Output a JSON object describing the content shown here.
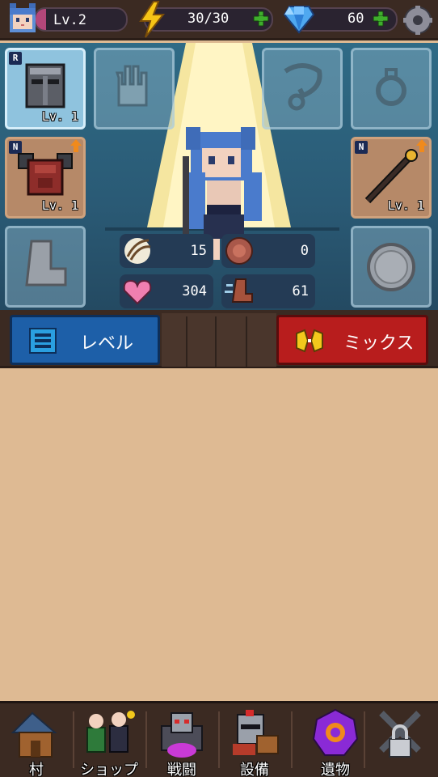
{
  "top_bar": {
    "level_label": "Lv.2",
    "level_progress": 0.12,
    "energy": "30/30",
    "gems": "60",
    "icons": [
      "player-avatar-icon",
      "lightning-icon",
      "plus-icon",
      "diamond-icon",
      "gear-icon"
    ]
  },
  "equipment": {
    "helmet": {
      "rarity": "R",
      "level": "Lv. 1"
    },
    "armor": {
      "rarity": "N",
      "level": "Lv. 1"
    },
    "weapon": {
      "rarity": "N",
      "level": "Lv. 1"
    }
  },
  "stats": {
    "attack": "15",
    "defense": "0",
    "hp": "304",
    "speed": "61"
  },
  "actions": {
    "level_button": "レベル",
    "mix_button": "ミックス"
  },
  "nav": {
    "village": "村",
    "shop": "ショップ",
    "battle": "戦闘",
    "equipment": "設備",
    "relics": "遺物"
  },
  "colors": {
    "level_button": "#1d5fa8",
    "mix_button": "#b81d1d",
    "panel_bg": "#deba93",
    "hero_bg": "#2f6b86"
  }
}
